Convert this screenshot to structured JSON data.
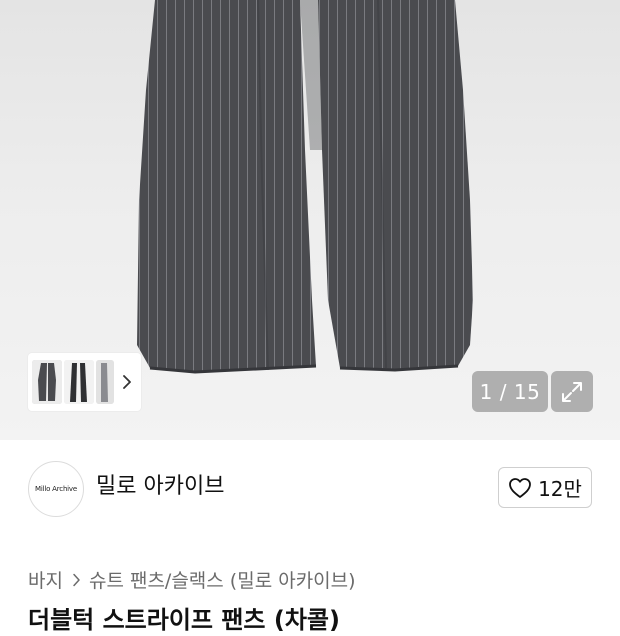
{
  "gallery": {
    "counter_text": "1 / 15",
    "icons": {
      "next": "chevron-right-icon",
      "expand": "expand-arrows-icon"
    }
  },
  "seller": {
    "logo_text": "Millo Archive",
    "name": "밀로 아카이브"
  },
  "like": {
    "count": "12만",
    "icon": "heart-outline-icon"
  },
  "breadcrumb": {
    "items": [
      "바지",
      "슈트 팬츠/슬랙스 (밀로 아카이브)"
    ]
  },
  "product": {
    "title": "더블턱 스트라이프 팬츠 (차콜)"
  },
  "colors": {
    "pants": "#4a4b4f",
    "stripe": "#8a8b90",
    "hero_bg": "#ececec"
  }
}
